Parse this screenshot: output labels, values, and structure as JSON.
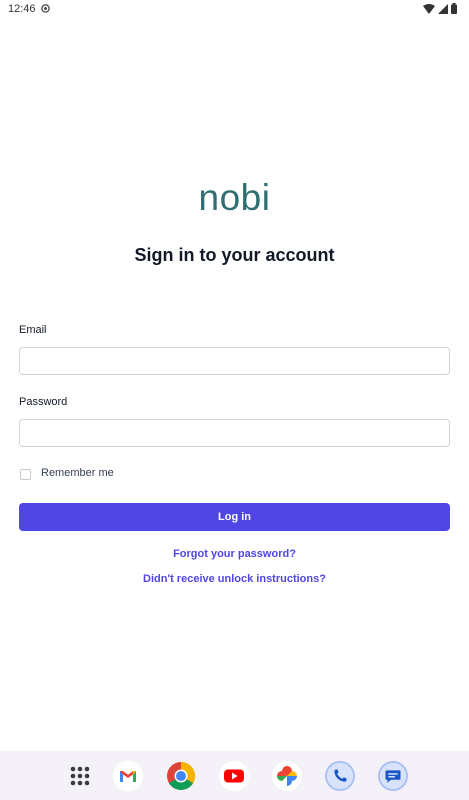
{
  "status_bar": {
    "time": "12:46"
  },
  "app": {
    "logo_text": "nobi",
    "heading": "Sign in to your account"
  },
  "form": {
    "email_label": "Email",
    "email_value": "",
    "email_placeholder": "",
    "password_label": "Password",
    "password_value": "",
    "password_placeholder": "",
    "remember_label": "Remember me",
    "remember_checked": false,
    "login_label": "Log in"
  },
  "links": {
    "forgot": "Forgot your password?",
    "unlock": "Didn't receive unlock instructions?"
  },
  "dock": {
    "apps": [
      "app-drawer-icon",
      "gmail-icon",
      "chrome-icon",
      "youtube-icon",
      "photos-icon",
      "phone-icon",
      "messages-icon"
    ]
  },
  "colors": {
    "brand": "#2f6f73",
    "accent": "#4f46e5",
    "text": "#111827",
    "dock_bg": "#f4f1f9"
  }
}
